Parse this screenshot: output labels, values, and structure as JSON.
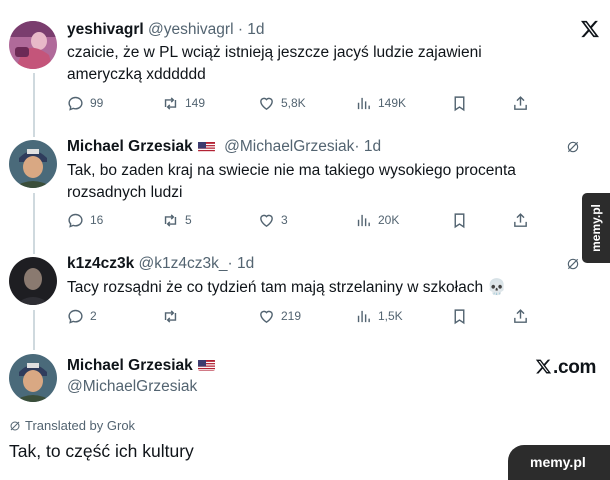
{
  "tweets": [
    {
      "name": "yeshivagrl",
      "handle": "@yeshivagrl",
      "time": "· 1d",
      "text": "czaicie, że w PL wciąż istnieją jeszcze jacyś ludzie zajawieni ameryczką xdddddd",
      "replies": "99",
      "retweets": "149",
      "likes": "5,8K",
      "views": "149K"
    },
    {
      "name": "Michael Grzesiak",
      "handle": "@MichaelGrzesiak",
      "time": "· 1d",
      "text": "Tak, bo zaden kraj na swiecie nie ma takiego wysokiego procenta rozsadnych ludzi",
      "replies": "16",
      "retweets": "5",
      "likes": "3",
      "views": "20K"
    },
    {
      "name": "k1z4cz3k",
      "handle": "@k1z4cz3k_",
      "time": "· 1d",
      "text": "Tacy rozsądni że co tydzień tam mają strzelaniny w szkołach 💀",
      "replies": "2",
      "retweets": "",
      "likes": "219",
      "views": "1,5K"
    }
  ],
  "main_tweet": {
    "name": "Michael Grzesiak",
    "handle": "@MichaelGrzesiak",
    "source_label": ".com",
    "translated_label": "Translated by Grok",
    "text": "Tak, to część ich kultury"
  },
  "watermarks": {
    "side": "memy.pl",
    "corner": "memy.pl"
  },
  "icons": [
    "x-logo-icon",
    "reply-icon",
    "retweet-icon",
    "like-icon",
    "views-icon",
    "bookmark-icon",
    "share-icon",
    "grok-icon",
    "us-flag-icon"
  ],
  "colors": {
    "text": "#0f1419",
    "secondary": "#536471",
    "thread_line": "#cfd9de",
    "watermark_bg": "#2c2c2c"
  }
}
